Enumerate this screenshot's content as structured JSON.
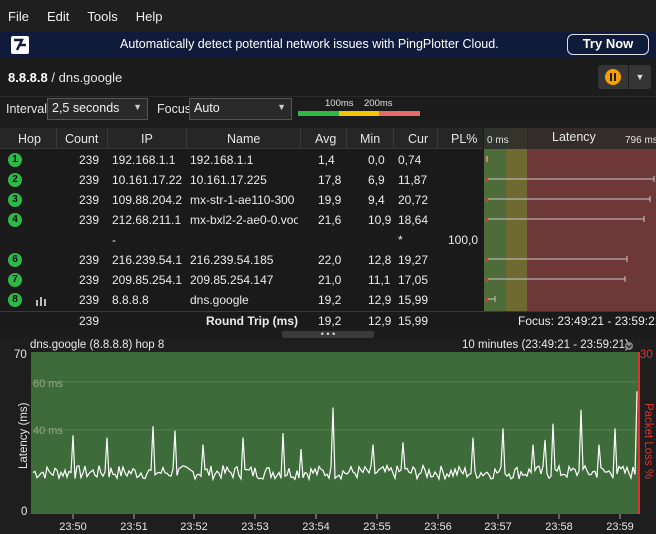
{
  "menu": [
    "File",
    "Edit",
    "Tools",
    "Help"
  ],
  "banner": {
    "message": "Automatically detect potential network issues with PingPlotter Cloud.",
    "button": "Try Now"
  },
  "target": {
    "ip": "8.8.8.8",
    "separator": " / ",
    "name": "dns.google"
  },
  "controls": {
    "interval_label": "Interval",
    "interval_value": "2,5 seconds",
    "focus_label": "Focus",
    "focus_value": "Auto",
    "scale_100": "100ms",
    "scale_200": "200ms"
  },
  "table": {
    "headers": [
      "Hop",
      "Count",
      "IP",
      "Name",
      "Avg",
      "Min",
      "Cur",
      "PL%"
    ],
    "rows": [
      {
        "hop": "1",
        "count": "239",
        "ip": "192.168.1.1",
        "name": "192.168.1.1",
        "avg": "1,4",
        "min": "0,0",
        "cur": "0,74",
        "pl": ""
      },
      {
        "hop": "2",
        "count": "239",
        "ip": "10.161.17.22",
        "name": "10.161.17.225",
        "avg": "17,8",
        "min": "6,9",
        "cur": "11,87",
        "pl": ""
      },
      {
        "hop": "3",
        "count": "239",
        "ip": "109.88.204.2",
        "name": "mx-str-1-ae110-300",
        "avg": "19,9",
        "min": "9,4",
        "cur": "20,72",
        "pl": ""
      },
      {
        "hop": "4",
        "count": "239",
        "ip": "212.68.211.1",
        "name": "mx-bxl2-2-ae0-0.voo",
        "avg": "21,6",
        "min": "10,9",
        "cur": "18,64",
        "pl": ""
      },
      {
        "hop": "",
        "count": "",
        "ip": "-",
        "name": "",
        "avg": "",
        "min": "",
        "cur": "*",
        "pl": "100,0"
      },
      {
        "hop": "6",
        "count": "239",
        "ip": "216.239.54.1",
        "name": "216.239.54.185",
        "avg": "22,0",
        "min": "12,8",
        "cur": "19,27",
        "pl": ""
      },
      {
        "hop": "7",
        "count": "239",
        "ip": "209.85.254.1",
        "name": "209.85.254.147",
        "avg": "21,0",
        "min": "11,1",
        "cur": "17,05",
        "pl": ""
      },
      {
        "hop": "8",
        "count": "239",
        "ip": "8.8.8.8",
        "name": "dns.google",
        "avg": "19,2",
        "min": "12,9",
        "cur": "15,99",
        "pl": ""
      }
    ],
    "total": {
      "count": "239",
      "label": "Round Trip (ms)",
      "avg": "19,2",
      "min": "12,9",
      "cur": "15,99",
      "focus": "Focus: 23:49:21 - 23:59:21"
    }
  },
  "latency_panel": {
    "title": "Latency",
    "min_label": "0 ms",
    "max_label": "796 ms"
  },
  "graph": {
    "title": "dns.google (8.8.8.8) hop 8",
    "range": "10 minutes (23:49:21 - 23:59:21)",
    "ylabel": "Latency (ms)",
    "ylabel_right": "Packet Loss %",
    "y_top": "70",
    "y_bottom": "0",
    "y_right_top": "30",
    "grid_60": "60 ms",
    "grid_40": "40 ms",
    "x_ticks": [
      "23:50",
      "23:51",
      "23:52",
      "23:53",
      "23:54",
      "23:55",
      "23:56",
      "23:57",
      "23:58",
      "23:59"
    ]
  },
  "colors": {
    "hop_green": "#2fb84a",
    "graph_bg": "#3d6b3a",
    "latency_red": "#7a3b3b",
    "accent_orange": "#f5a000"
  }
}
